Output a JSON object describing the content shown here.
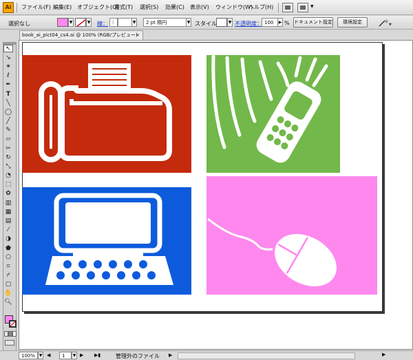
{
  "menu": {
    "app_logo": "Ai",
    "items": [
      "ファイル(F)",
      "編集(E)",
      "オブジェクト(O)",
      "書式(T)",
      "選択(S)",
      "効果(C)",
      "表示(V)",
      "ウィンドウ(W)",
      "ヘルプ(H)"
    ]
  },
  "control": {
    "selection_label": "選択なし",
    "stroke_label": "線：",
    "stroke_value": "2 pt 楕円",
    "style_label": "スタイル：",
    "opacity_label": "不透明度：",
    "opacity_value": "100",
    "opacity_unit": "%",
    "doc_setup_label": "ドキュメント設定",
    "prefs_label": "環境設定",
    "fill_color": "#ff88ee"
  },
  "document": {
    "tab_title": "book_ai_pict04_cs4.ai @ 100% (RGB/プレビュー)",
    "tab_close": "×",
    "tiles": [
      {
        "name": "fax",
        "color": "#c42b0c"
      },
      {
        "name": "mobile-phone",
        "color": "#72b84a"
      },
      {
        "name": "laptop",
        "color": "#0d5bdc"
      },
      {
        "name": "mouse",
        "color": "#ff88ee"
      }
    ]
  },
  "status": {
    "zoom": "100%",
    "page": "1",
    "file_status": "管理外のファイル"
  }
}
